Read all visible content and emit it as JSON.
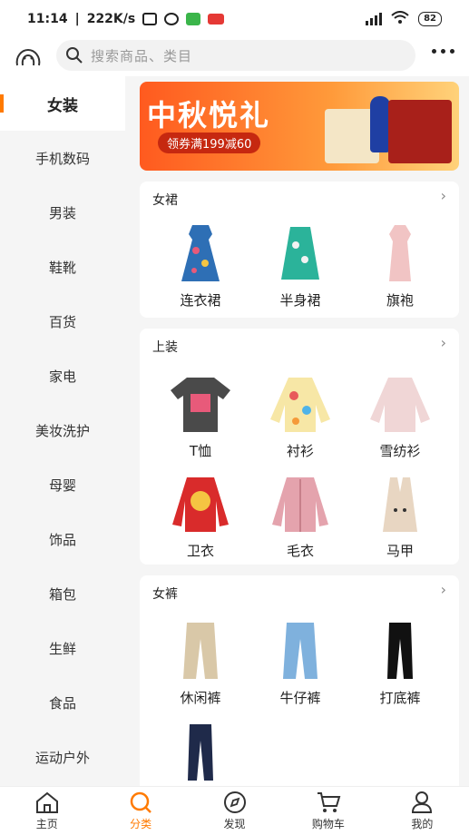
{
  "status_bar": {
    "time": "11:14",
    "speed": "222K/s",
    "battery": "82"
  },
  "search": {
    "placeholder": "搜索商品、类目"
  },
  "sidebar": {
    "items": [
      {
        "label": "女装"
      },
      {
        "label": "手机数码"
      },
      {
        "label": "男装"
      },
      {
        "label": "鞋靴"
      },
      {
        "label": "百货"
      },
      {
        "label": "家电"
      },
      {
        "label": "美妆洗护"
      },
      {
        "label": "母婴"
      },
      {
        "label": "饰品"
      },
      {
        "label": "箱包"
      },
      {
        "label": "生鲜"
      },
      {
        "label": "食品"
      },
      {
        "label": "运动户外"
      }
    ]
  },
  "banner": {
    "title": "中秋悦礼",
    "subtitle": "领券满199减60"
  },
  "sections": [
    {
      "title": "女裙",
      "items": [
        {
          "label": "连衣裙"
        },
        {
          "label": "半身裙"
        },
        {
          "label": "旗袍"
        }
      ]
    },
    {
      "title": "上装",
      "items": [
        {
          "label": "T恤"
        },
        {
          "label": "衬衫"
        },
        {
          "label": "雪纺衫"
        },
        {
          "label": "卫衣"
        },
        {
          "label": "毛衣"
        },
        {
          "label": "马甲"
        }
      ]
    },
    {
      "title": "女裤",
      "items": [
        {
          "label": "休闲裤"
        },
        {
          "label": "牛仔裤"
        },
        {
          "label": "打底裤"
        }
      ]
    }
  ],
  "tabbar": {
    "items": [
      {
        "label": "主页",
        "icon": "home-icon"
      },
      {
        "label": "分类",
        "icon": "category-icon"
      },
      {
        "label": "发现",
        "icon": "compass-icon"
      },
      {
        "label": "购物车",
        "icon": "cart-icon"
      },
      {
        "label": "我的",
        "icon": "user-icon"
      }
    ]
  },
  "colors": {
    "accent": "#ff7a00",
    "banner_red": "#ff5a1f"
  }
}
